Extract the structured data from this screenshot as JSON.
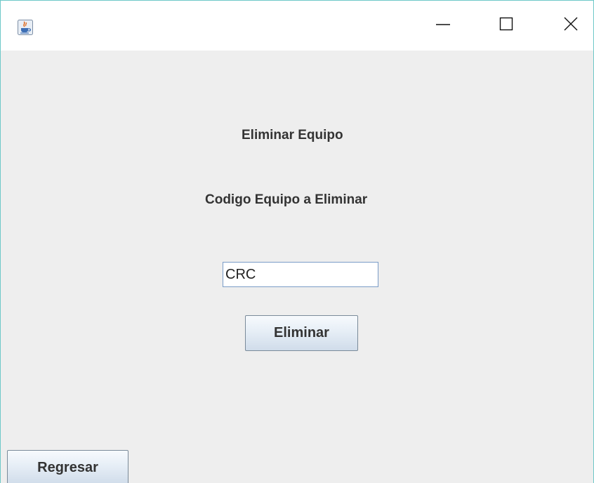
{
  "window": {
    "title": "",
    "icon": "java-cup-icon",
    "controls": {
      "minimize_icon": "minimize-icon",
      "maximize_icon": "maximize-icon",
      "close_icon": "close-icon"
    }
  },
  "form": {
    "title": "Eliminar Equipo",
    "code_label": "Codigo Equipo a Eliminar",
    "code_value": "CRC",
    "delete_button": "Eliminar",
    "back_button": "Regresar"
  },
  "colors": {
    "background": "#eeeeee",
    "window_border": "#6ec9c9",
    "input_border": "#7a9cc7"
  }
}
